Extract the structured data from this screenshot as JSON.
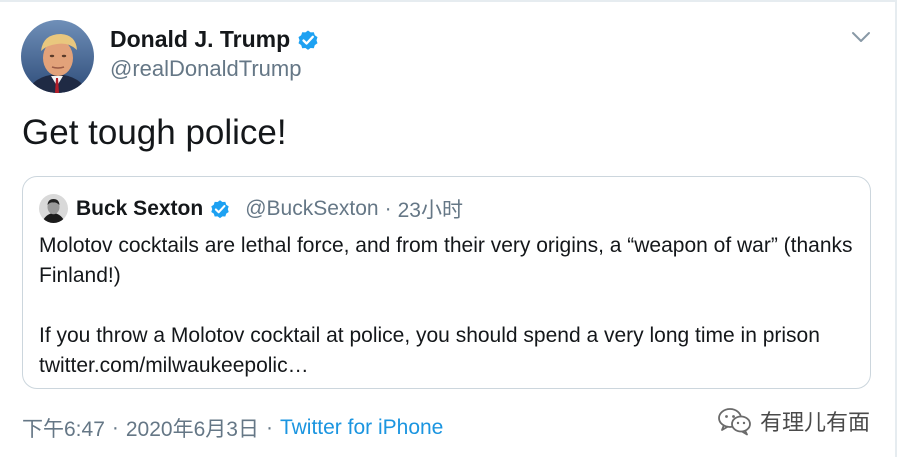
{
  "tweet": {
    "author_name": "Donald J. Trump",
    "author_handle": "@realDonaldTrump",
    "text": "Get tough police!",
    "time": "下午6:47",
    "date": "2020年6月3日",
    "separator": "·",
    "source": "Twitter for iPhone"
  },
  "quote": {
    "author_name": "Buck Sexton",
    "author_handle": "@BuckSexton",
    "separator": "·",
    "time": "23小时",
    "paragraph1": "Molotov cocktails are lethal force, and from their very origins, a “weapon of war” (thanks Finland!)",
    "paragraph2": "If you throw a Molotov cocktail at police, you should spend a very long time in prison twitter.com/milwaukeepolic…"
  },
  "watermark": {
    "text": "有理儿有面"
  },
  "colors": {
    "text_primary": "#14171a",
    "text_secondary": "#657786",
    "link": "#1b95e0",
    "verified": "#1da1f2",
    "border": "#ccd6dd"
  },
  "icons": {
    "verified": "verified-badge-icon",
    "caret": "chevron-down-icon",
    "watermark": "wechat-logo-icon"
  }
}
